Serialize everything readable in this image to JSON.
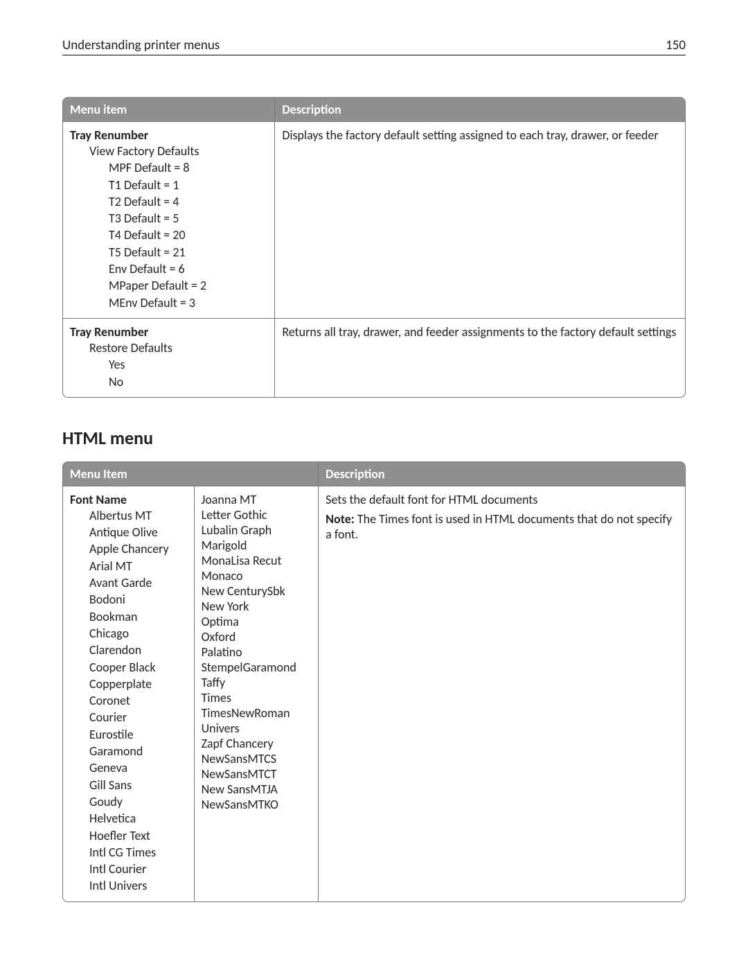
{
  "header": {
    "title": "Understanding printer menus",
    "page_number": "150"
  },
  "table1": {
    "headers": [
      "Menu item",
      "Description"
    ],
    "rows": [
      {
        "root": "Tray Renumber",
        "sub1": "View Factory Defaults",
        "sub2": [
          "MPF Default = 8",
          "T1 Default = 1",
          "T2 Default = 4",
          "T3 Default = 5",
          "T4 Default = 20",
          "T5 Default = 21",
          "Env Default = 6",
          "MPaper Default = 2",
          "MEnv Default = 3"
        ],
        "desc": "Displays the factory default setting assigned to each tray, drawer, or feeder"
      },
      {
        "root": "Tray Renumber",
        "sub1": "Restore Defaults",
        "sub2": [
          "Yes",
          "No"
        ],
        "desc": "Returns all tray, drawer, and feeder assignments to the factory default settings"
      }
    ]
  },
  "section_heading": "HTML menu",
  "table2": {
    "headers": [
      "Menu Item",
      "Description"
    ],
    "row": {
      "root": "Font Name",
      "fonts_col1": [
        "Albertus MT",
        "Antique Olive",
        "Apple Chancery",
        "Arial MT",
        "Avant Garde",
        "Bodoni",
        "Bookman",
        "Chicago",
        "Clarendon",
        "Cooper Black",
        "Copperplate",
        "Coronet",
        "Courier",
        "Eurostile",
        "Garamond",
        "Geneva",
        "Gill Sans",
        "Goudy",
        "Helvetica",
        "Hoefler Text",
        "Intl CG Times",
        "Intl Courier",
        "Intl Univers"
      ],
      "fonts_col2": [
        "Joanna MT",
        "Letter Gothic",
        "Lubalin Graph",
        "Marigold",
        "MonaLisa Recut",
        "Monaco",
        "New CenturySbk",
        "New York",
        "Optima",
        "Oxford",
        "Palatino",
        "StempelGaramond",
        "Taffy",
        "Times",
        "TimesNewRoman",
        "Univers",
        "Zapf Chancery",
        "NewSansMTCS",
        "NewSansMTCT",
        "New SansMTJA",
        "NewSansMTKO"
      ],
      "desc": "Sets the default font for HTML documents",
      "note_label": "Note:",
      "note_text": " The Times font is used in HTML documents that do not specify a font."
    }
  }
}
